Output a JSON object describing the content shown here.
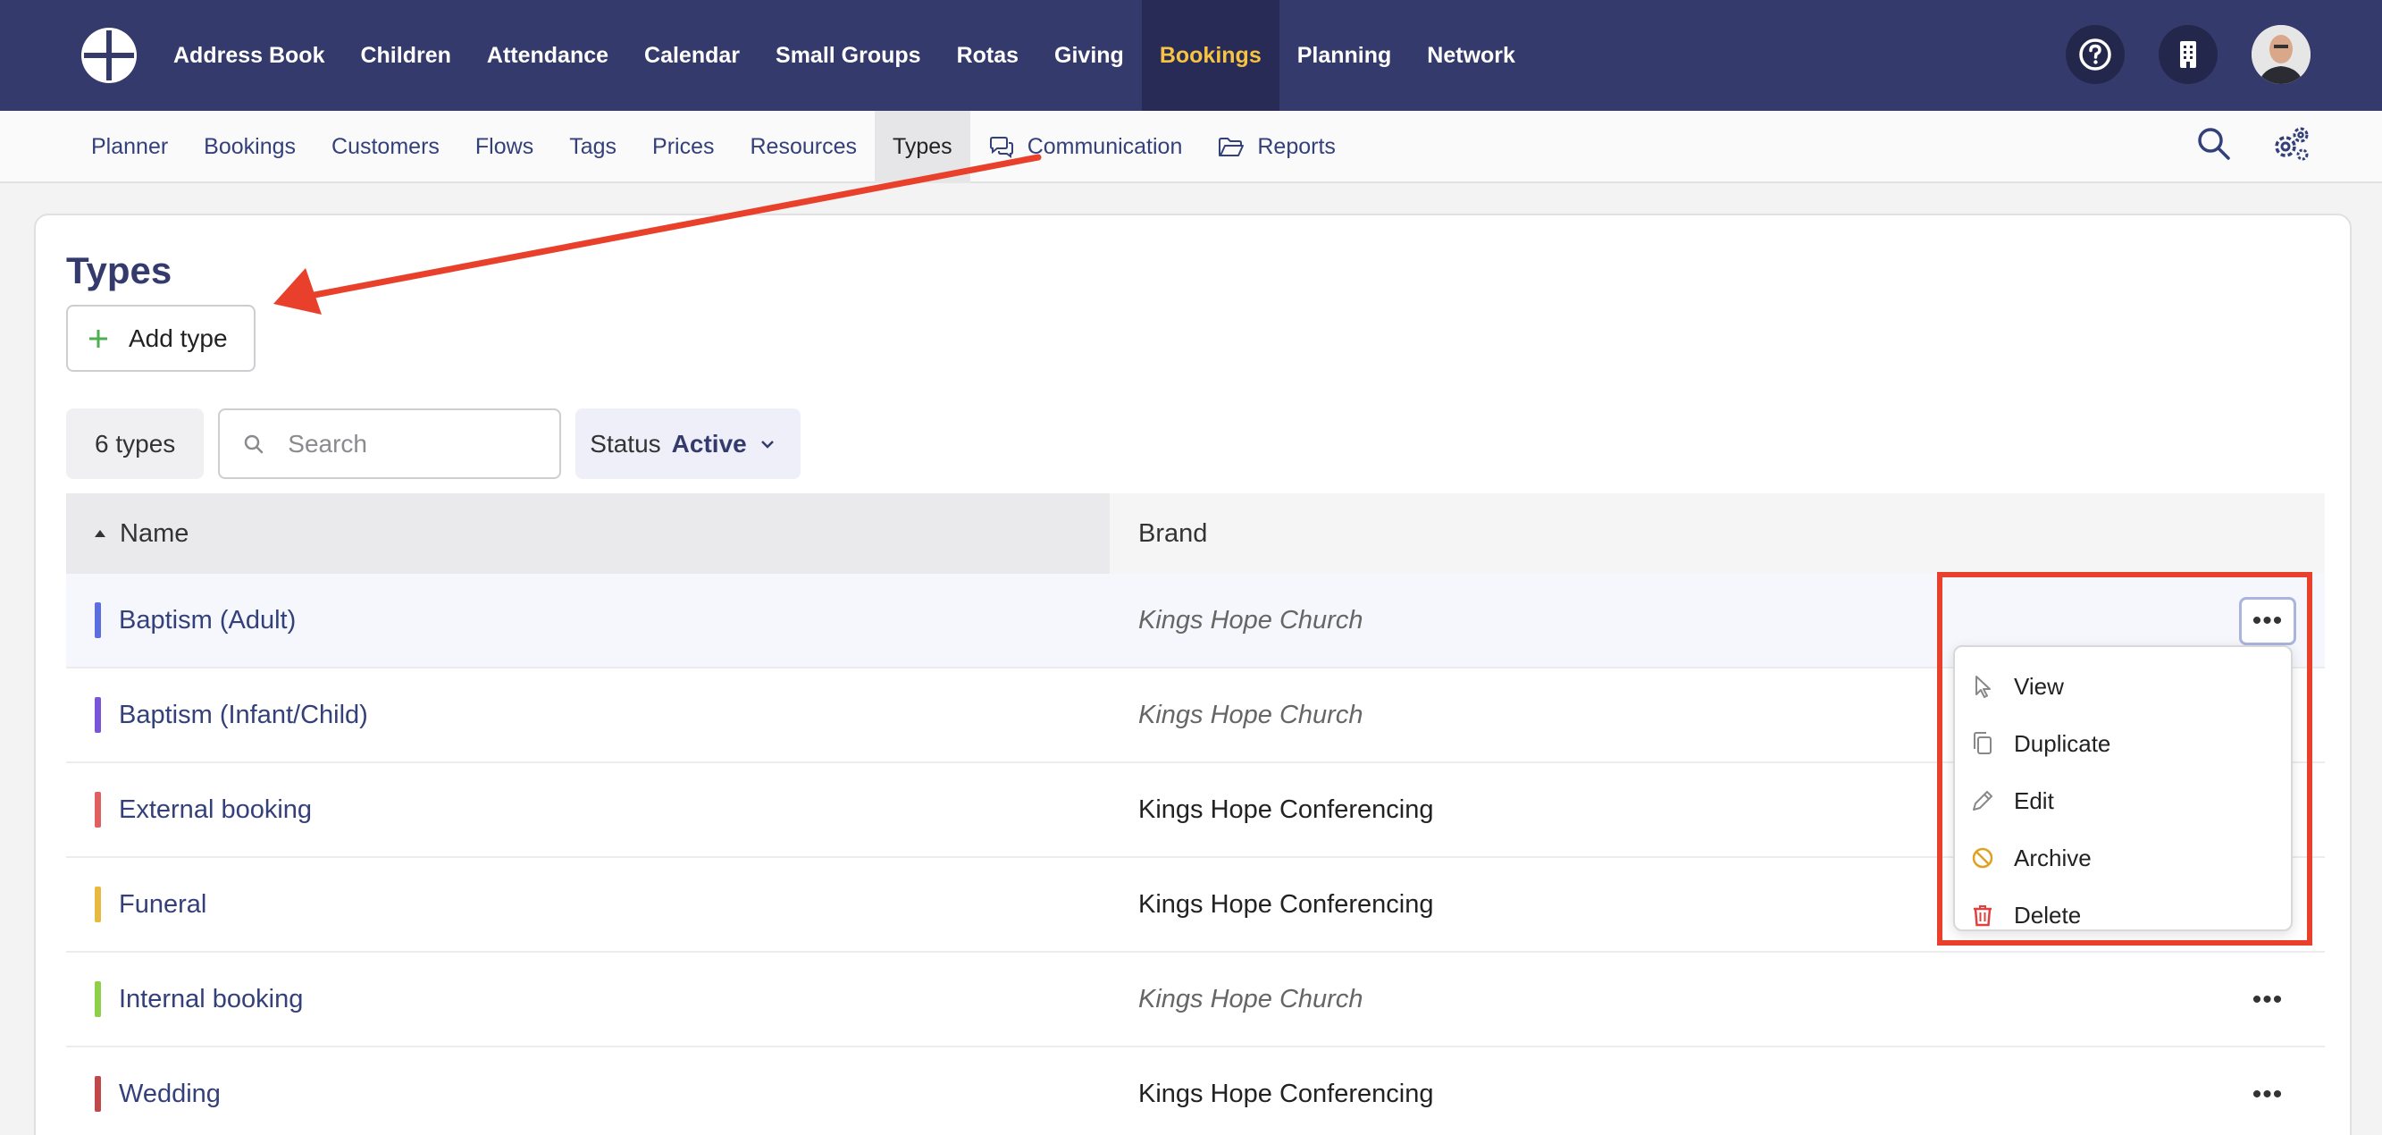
{
  "topnav": {
    "items": [
      "Address Book",
      "Children",
      "Attendance",
      "Calendar",
      "Small Groups",
      "Rotas",
      "Giving",
      "Bookings",
      "Planning",
      "Network"
    ],
    "active_index": 7
  },
  "subnav": {
    "items": [
      "Planner",
      "Bookings",
      "Customers",
      "Flows",
      "Tags",
      "Prices",
      "Resources",
      "Types",
      "Communication",
      "Reports"
    ],
    "active_index": 7
  },
  "page": {
    "title": "Types",
    "add_label": "Add type"
  },
  "filters": {
    "count": "6 types",
    "search_placeholder": "Search",
    "status_label": "Status",
    "status_value": "Active"
  },
  "table": {
    "headers": {
      "name": "Name",
      "brand": "Brand"
    },
    "rows": [
      {
        "name": "Baptism (Adult)",
        "brand": "Kings Hope Church",
        "color": "#5b6ee0",
        "italic": true
      },
      {
        "name": "Baptism (Infant/Child)",
        "brand": "Kings Hope Church",
        "color": "#7a55d8",
        "italic": true
      },
      {
        "name": "External booking",
        "brand": "Kings Hope Conferencing",
        "color": "#e06060",
        "italic": false
      },
      {
        "name": "Funeral",
        "brand": "Kings Hope Conferencing",
        "color": "#e8b840",
        "italic": false
      },
      {
        "name": "Internal booking",
        "brand": "Kings Hope Church",
        "color": "#8fcf4a",
        "italic": true
      },
      {
        "name": "Wedding",
        "brand": "Kings Hope Conferencing",
        "color": "#c04848",
        "italic": false
      }
    ]
  },
  "menu": {
    "items": [
      "View",
      "Duplicate",
      "Edit",
      "Archive",
      "Delete"
    ]
  },
  "colors": {
    "nav_bg": "#353a6c",
    "nav_active_text": "#f6c343",
    "annotation_red": "#e8402a"
  }
}
